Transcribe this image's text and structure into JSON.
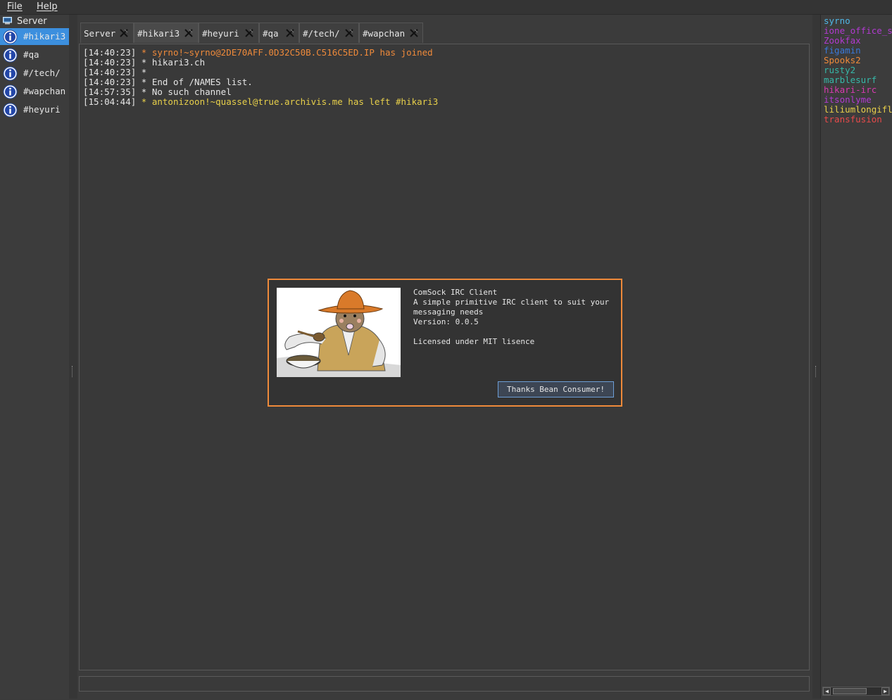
{
  "menubar": {
    "file": "File",
    "help": "Help"
  },
  "sidebar": {
    "server_label": "Server",
    "channels": [
      {
        "label": "#hikari3",
        "selected": true
      },
      {
        "label": "#qa",
        "selected": false
      },
      {
        "label": "#/tech/",
        "selected": false
      },
      {
        "label": "#wapchan",
        "selected": false
      },
      {
        "label": "#heyuri",
        "selected": false
      }
    ]
  },
  "tabs": [
    {
      "label": "Server",
      "active": false
    },
    {
      "label": "#hikari3",
      "active": true
    },
    {
      "label": "#heyuri",
      "active": false
    },
    {
      "label": "#qa",
      "active": false
    },
    {
      "label": "#/tech/",
      "active": false
    },
    {
      "label": "#wapchan",
      "active": false
    }
  ],
  "chat": {
    "lines": [
      {
        "ts": "[14:40:23]",
        "text": "* syrno!~syrno@2DE70AFF.0D32C50B.C516C5ED.IP has joined",
        "color": "orange"
      },
      {
        "ts": "[14:40:23]",
        "text": "* hikari3.ch",
        "color": "normal"
      },
      {
        "ts": "[14:40:23]",
        "text": "*",
        "color": "normal"
      },
      {
        "ts": "[14:40:23]",
        "text": "* End of /NAMES list.",
        "color": "normal"
      },
      {
        "ts": "[14:57:35]",
        "text": "* No such channel",
        "color": "normal"
      },
      {
        "ts": "[15:04:44]",
        "text": "* antonizoon!~quassel@true.archivis.me has left #hikari3",
        "color": "yellow"
      }
    ]
  },
  "users": [
    {
      "name": "syrno",
      "color": "#4fb8e8"
    },
    {
      "name": "ione_office_se",
      "color": "#b13ad0"
    },
    {
      "name": "Zookfax",
      "color": "#b13ad0"
    },
    {
      "name": "figamin",
      "color": "#3a78d8"
    },
    {
      "name": "Spooks2",
      "color": "#ef8a3a"
    },
    {
      "name": "rusty2",
      "color": "#36b8a8"
    },
    {
      "name": "marblesurf",
      "color": "#36b8a8"
    },
    {
      "name": "hikari-irc",
      "color": "#d83ab0"
    },
    {
      "name": "itsonlyme",
      "color": "#b13ad0"
    },
    {
      "name": "liliumlongiflo",
      "color": "#e8d04a"
    },
    {
      "name": "transfusion",
      "color": "#e84a4a"
    }
  ],
  "dialog": {
    "lines": [
      "ComSock IRC Client",
      "A simple primitive IRC client to suit your",
      "messaging needs",
      "Version: 0.0.5",
      "",
      "Licensed under MIT lisence"
    ],
    "button_label": "Thanks Bean Consumer!"
  }
}
